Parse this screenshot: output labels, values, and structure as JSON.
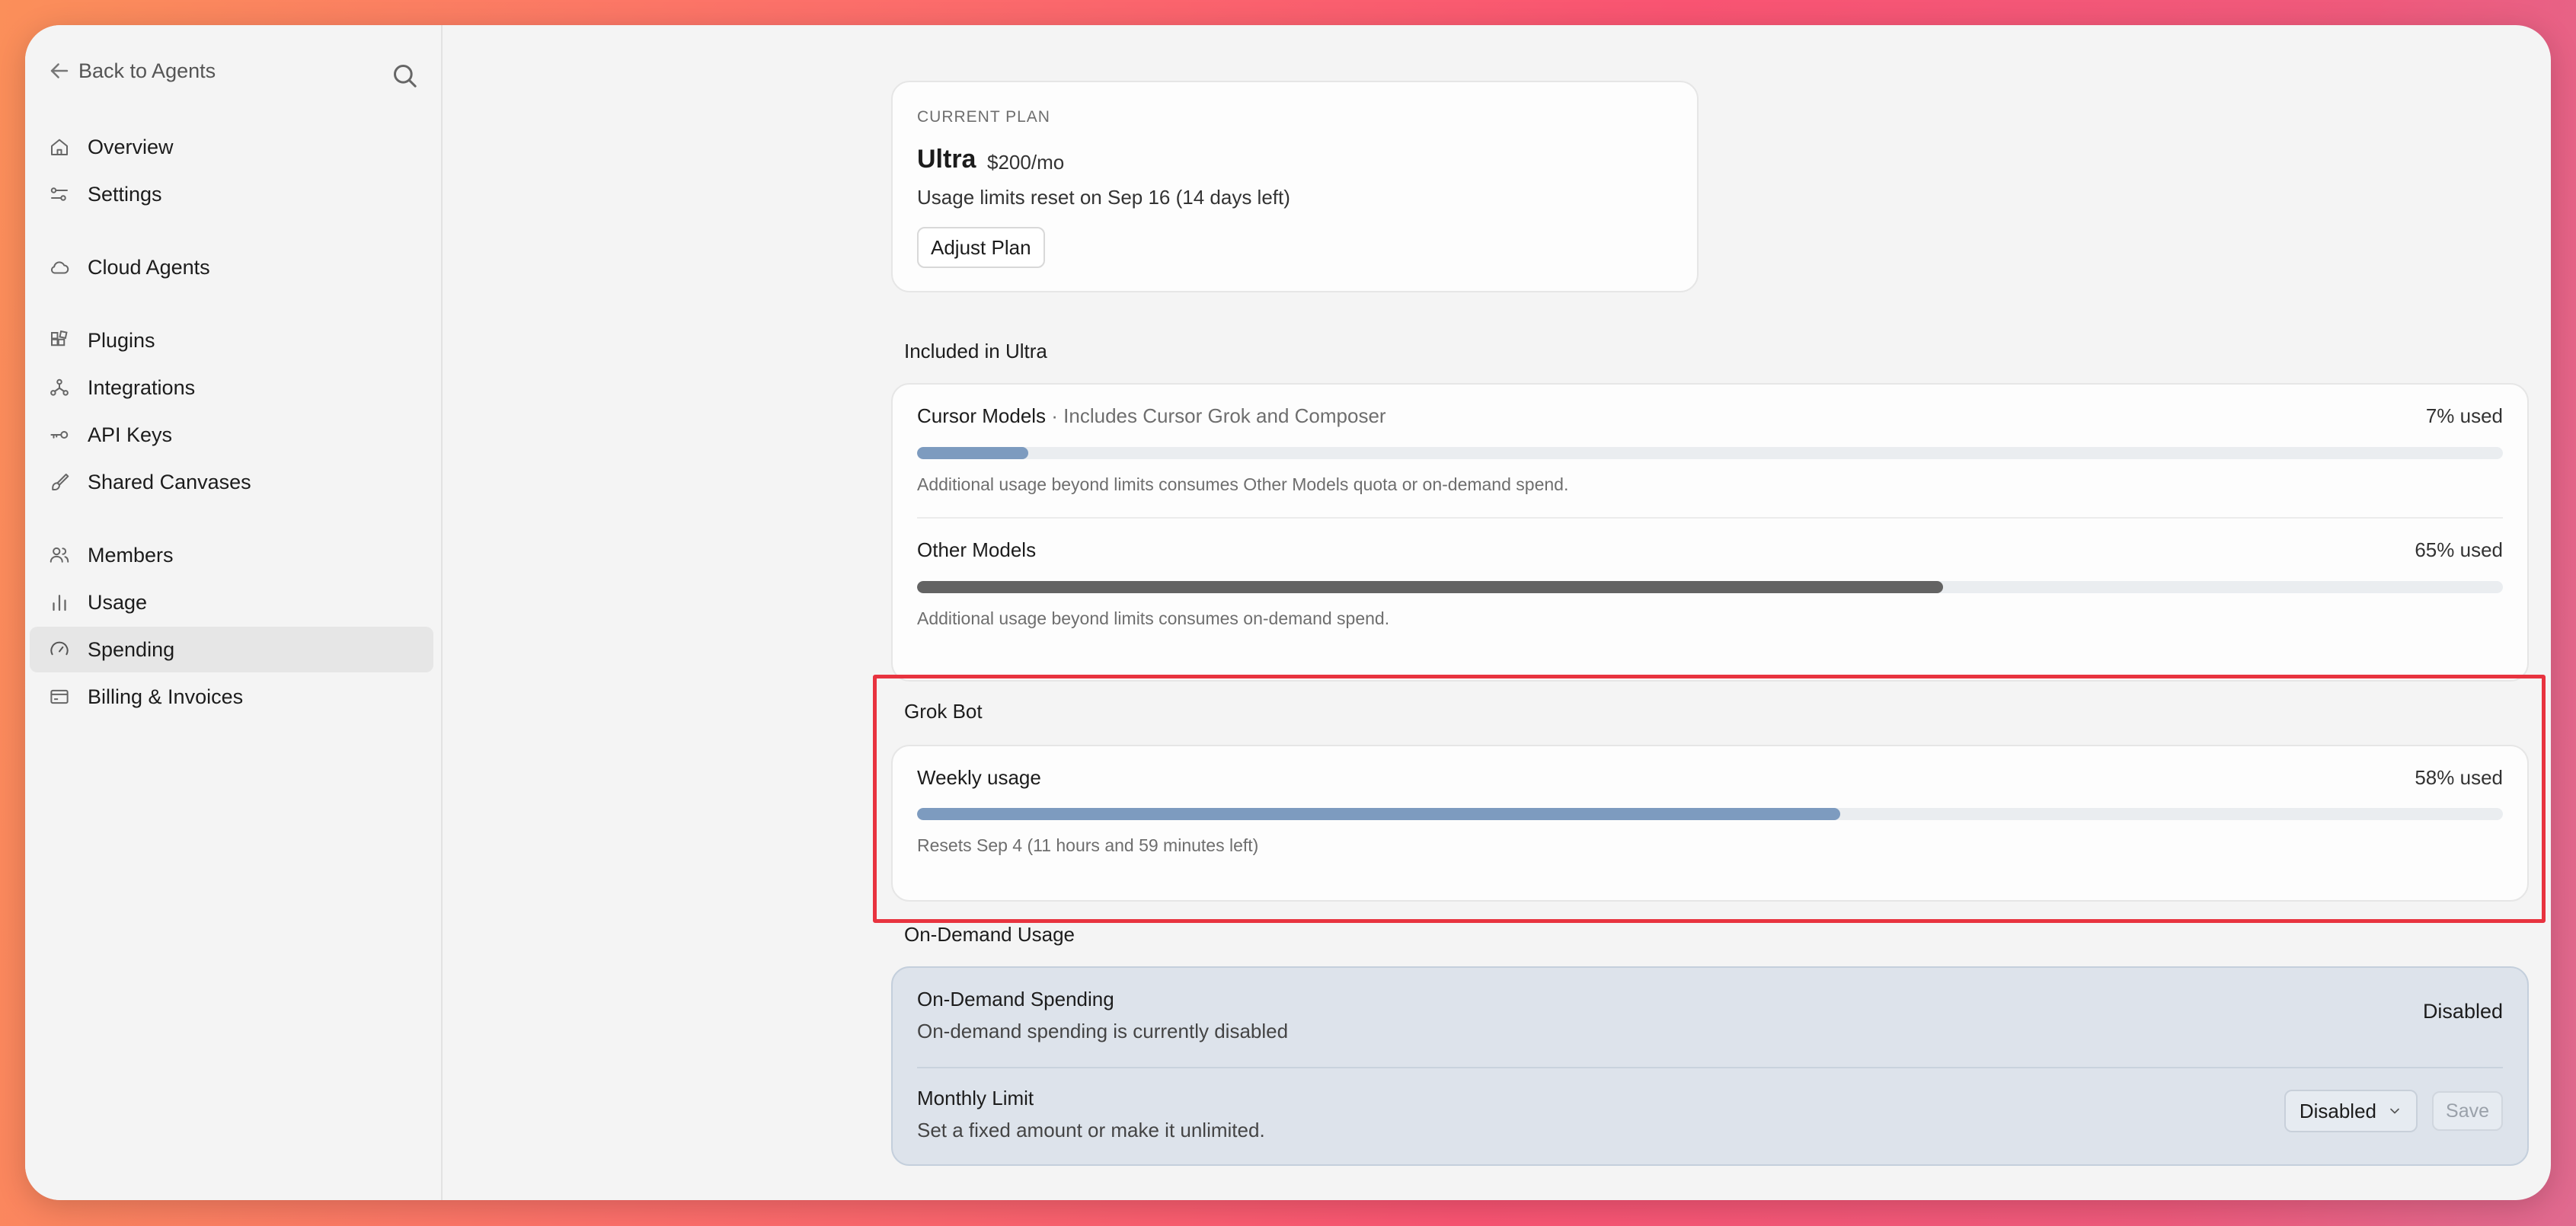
{
  "sidebar": {
    "back_label": "Back to Agents",
    "items": [
      {
        "label": "Overview",
        "icon": "home-icon"
      },
      {
        "label": "Settings",
        "icon": "sliders-icon"
      },
      {
        "label": "Cloud Agents",
        "icon": "cloud-icon"
      },
      {
        "label": "Plugins",
        "icon": "plugins-icon"
      },
      {
        "label": "Integrations",
        "icon": "integrations-icon"
      },
      {
        "label": "API Keys",
        "icon": "key-icon"
      },
      {
        "label": "Shared Canvases",
        "icon": "brush-icon"
      },
      {
        "label": "Members",
        "icon": "members-icon"
      },
      {
        "label": "Usage",
        "icon": "bar-chart-icon"
      },
      {
        "label": "Spending",
        "icon": "gauge-icon",
        "active": true
      },
      {
        "label": "Billing & Invoices",
        "icon": "card-icon"
      }
    ]
  },
  "plan": {
    "eyebrow": "CURRENT PLAN",
    "name": "Ultra",
    "price": "$200/mo",
    "reset_text": "Usage limits reset on Sep 16 (14 days left)",
    "adjust_label": "Adjust Plan"
  },
  "included": {
    "title": "Included in Ultra",
    "rows": [
      {
        "name": "Cursor Models",
        "detail": " · Includes Cursor Grok and Composer",
        "used_label": "7% used",
        "fraction": 0.07,
        "note": "Additional usage beyond limits consumes Other Models quota or on-demand spend.",
        "color": "#7d9bbf"
      },
      {
        "name": "Other Models",
        "detail": "",
        "used_label": "65% used",
        "fraction": 0.647,
        "note": "Additional usage beyond limits consumes on-demand spend.",
        "color": "#636363"
      }
    ]
  },
  "grok": {
    "title": "Grok Bot",
    "row_name": "Weekly usage",
    "used_label": "58% used",
    "fraction": 0.582,
    "note": "Resets Sep 4 (11 hours and 59 minutes left)",
    "color": "#7d9bbf"
  },
  "ondemand": {
    "title": "On-Demand Usage",
    "spending_title": "On-Demand Spending",
    "spending_sub": "On-demand spending is currently disabled",
    "spending_status": "Disabled",
    "limit_title": "Monthly Limit",
    "limit_sub": "Set a fixed amount or make it unlimited.",
    "select_value": "Disabled",
    "save_label": "Save"
  },
  "colors": {
    "accent_bar": "#7d9bbf",
    "dark_bar": "#636363",
    "highlight": "#e8333f"
  }
}
